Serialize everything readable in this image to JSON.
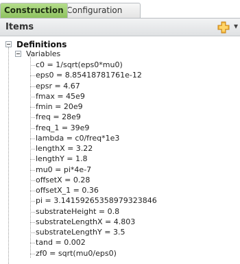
{
  "tabs": {
    "construction": "Construction",
    "configuration": "Configuration"
  },
  "header": {
    "title": "Items",
    "add_icon": "add-plus-icon",
    "dropdown_icon": "chevron-down-icon"
  },
  "tree": {
    "definitions_label": "Definitions",
    "variables_label": "Variables",
    "variables": [
      "c0 = 1/sqrt(eps0*mu0)",
      "eps0 = 8.85418781761e-12",
      "epsr = 4.67",
      "fmax = 45e9",
      "fmin = 20e9",
      "freq = 28e9",
      "freq_1 = 39e9",
      "lambda = c0/freq*1e3",
      "lengthX = 3.22",
      "lengthY = 1.8",
      "mu0 = pi*4e-7",
      "offsetX = 0.28",
      "offsetX_1 = 0.36",
      "pi = 3.14159265358979323846",
      "substrateHeight = 0.8",
      "substrateLengthX = 4.803",
      "substrateLengthY = 3.5",
      "tand = 0.002",
      "zf0 = sqrt(mu0/eps0)"
    ]
  },
  "colors": {
    "active_tab": "#9fd06e",
    "header_bg": "#e6e8ea"
  }
}
